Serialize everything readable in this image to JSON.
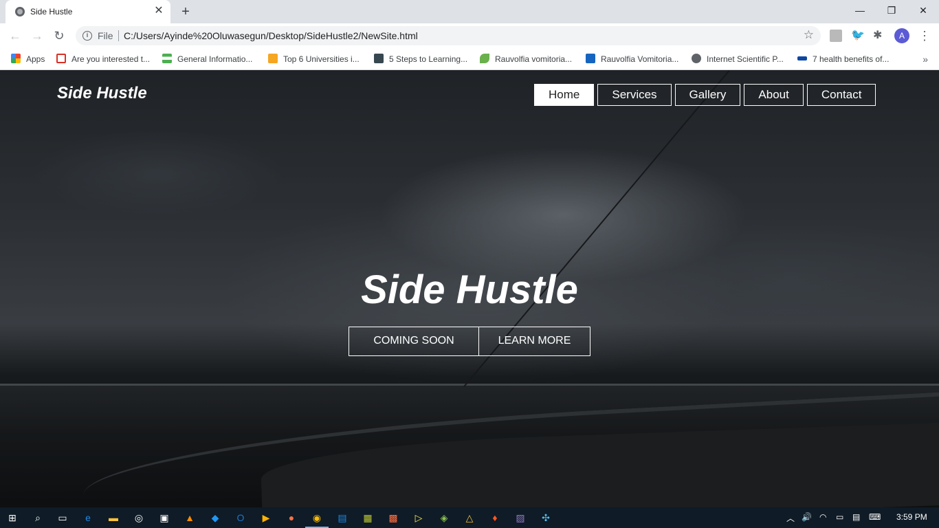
{
  "browser": {
    "tab_title": "Side Hustle",
    "new_tab_label": "+",
    "url_scheme": "File",
    "url": "C:/Users/Ayinde%20Oluwasegun/Desktop/SideHustle2/NewSite.html",
    "profile_initial": "A"
  },
  "bookmarks": [
    {
      "label": "Apps",
      "icon": "apps-grid-icon",
      "color": "#ea4335"
    },
    {
      "label": "Are you interested t...",
      "icon": "gmail-icon",
      "color": "#d93025"
    },
    {
      "label": "General Informatio...",
      "icon": "flag-icon",
      "color": "#4caf50"
    },
    {
      "label": "Top 6 Universities i...",
      "icon": "university-icon",
      "color": "#f5a623"
    },
    {
      "label": "5 Steps to Learning...",
      "icon": "lock-icon",
      "color": "#37474f"
    },
    {
      "label": "Rauvolfia vomitoria...",
      "icon": "leaf-icon",
      "color": "#6ab04c"
    },
    {
      "label": "Rauvolfia Vomitoria...",
      "icon": "webmd-icon",
      "color": "#1565c0"
    },
    {
      "label": "Internet Scientific P...",
      "icon": "globe-icon",
      "color": "#5f6368"
    },
    {
      "label": "7 health benefits of...",
      "icon": "site-icon",
      "color": "#0d47a1"
    }
  ],
  "site": {
    "brand": "Side Hustle",
    "nav": [
      "Home",
      "Services",
      "Gallery",
      "About",
      "Contact"
    ],
    "hero_title": "Side Hustle",
    "btn_coming": "COMING SOON",
    "btn_learn": "LEARN MORE"
  },
  "taskbar": {
    "time": "3:59 PM",
    "apps": [
      "start-icon",
      "search-icon",
      "task-view-icon",
      "edge-icon",
      "file-explorer-icon",
      "cortana-icon",
      "store-icon",
      "vlc-icon",
      "vscode-icon",
      "outlook-icon",
      "media-icon",
      "firefox-icon",
      "chrome-icon",
      "word-icon",
      "notepad-icon",
      "office-icon",
      "player-icon",
      "app-icon",
      "drive-icon",
      "brave-icon",
      "photo-icon",
      "slack-icon"
    ]
  }
}
